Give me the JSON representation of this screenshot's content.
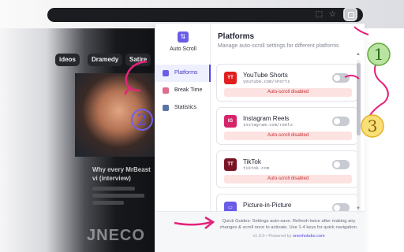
{
  "extension": {
    "name": "Auto Scroll",
    "nav": [
      {
        "label": "Platforms",
        "icon": "clipboard-icon"
      },
      {
        "label": "Break Time",
        "icon": "coffee-icon"
      },
      {
        "label": "Statistics",
        "icon": "chart-icon"
      }
    ],
    "title": "Platforms",
    "subtitle": "Manage auto-scroll settings for different platforms",
    "platforms": [
      {
        "badge": "YT",
        "name": "YouTube Shorts",
        "url": "youtube.com/shorts",
        "status": "Auto-scroll disabled",
        "color": "#e01e1e"
      },
      {
        "badge": "IG",
        "name": "Instagram Reels",
        "url": "instagram.com/reels",
        "status": "Auto-scroll disabled",
        "color": "#d6246b"
      },
      {
        "badge": "TT",
        "name": "TikTok",
        "url": "tiktok.com",
        "status": "Auto-scroll disabled",
        "color": "#7a1424"
      },
      {
        "badge": "",
        "name": "Picture-in-Picture",
        "url": "",
        "status": "",
        "color": "#6b5ce8"
      }
    ],
    "footer": "Quick Guides: Settings auto-save. Refresh twice after making any changes & scroll once to activate. Use 1-4 keys for quick navigation.",
    "version": "v1.0.0 • Powered by",
    "link": "oneshotabo.com"
  },
  "background": {
    "chips": [
      "ideos",
      "Dramedy",
      "Satire"
    ],
    "video_title": "Why every MrBeast vi (interview)",
    "logo_text": "JNECO"
  },
  "annotations": [
    "1",
    "2",
    "3"
  ],
  "colors": {
    "accent": "#4f46e5",
    "marker": "#e4237a",
    "marker_green": "#5fa83a",
    "marker_yellow": "#e3b21f"
  }
}
